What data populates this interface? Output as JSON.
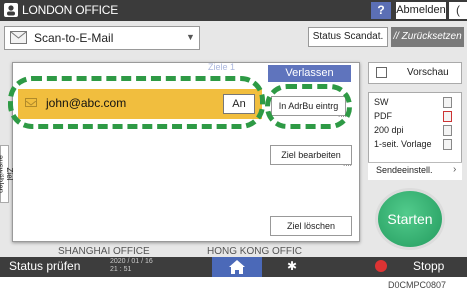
{
  "header": {
    "title": "LONDON OFFICE",
    "help_label": "?",
    "logout_label": "Abmelden",
    "moon_label": "("
  },
  "toolbar": {
    "mode_label": "Scan-to-E-Mail",
    "status_scan_label": "Status Scandat.",
    "reset_label": "// Zurücksetzen"
  },
  "dialog": {
    "faint_text": "Ziele 1",
    "leave_label": "Verlassen",
    "address": "john@abc.com",
    "an_label": "An",
    "addr_book_label": "In AdrBu eintrg",
    "edit_dest_label": "Ziel bearbeiten",
    "delete_dest_label": "Ziel löschen",
    "side_tab_label": "Ziel auswählen",
    "dots": "...."
  },
  "right_panel": {
    "preview_label": "Vorschau",
    "settings": [
      "SW",
      "PDF",
      "200 dpi",
      "1-seit. Vorlage"
    ],
    "send_settings_label": "Sendeeinstell.",
    "start_label": "Starten"
  },
  "background": {
    "shanghai": "SHANGHAI OFFICE",
    "hongkong": "HONG KONG OFFIC"
  },
  "bottombar": {
    "status_check_label": "Status prüfen",
    "date": "2020 / 01 / 16",
    "time": "21 : 51",
    "stop_label": "Stopp"
  },
  "caption": "D0CMPC0807",
  "colors": {
    "highlight": "#2e9a45",
    "selected_row": "#f1be3e",
    "accent": "#5f74bd"
  }
}
